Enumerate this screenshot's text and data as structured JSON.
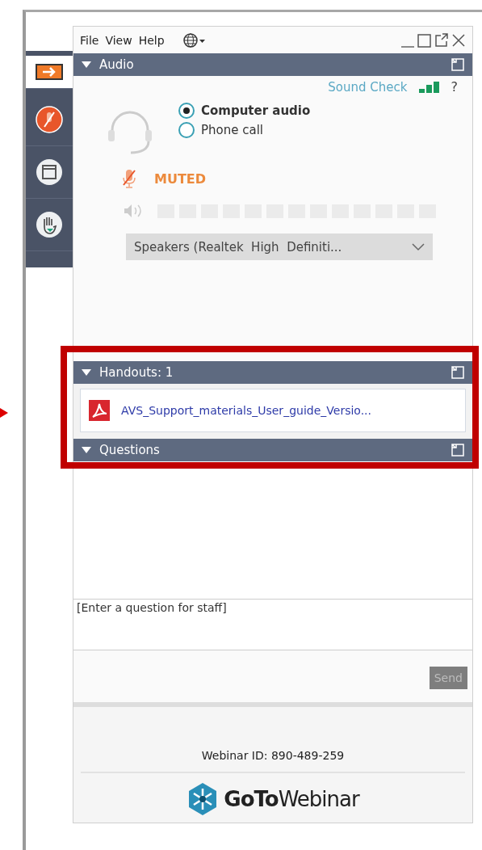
{
  "menu": [
    "File",
    "View",
    "Help"
  ],
  "sidebar": [
    {
      "kind": "arrow",
      "selected": true
    },
    {
      "kind": "mic",
      "selected": false
    },
    {
      "kind": "window",
      "selected": false
    },
    {
      "kind": "hand",
      "selected": false
    }
  ],
  "audio": {
    "title": "Audio",
    "expanded": true,
    "sound_check": "Sound Check",
    "help": "?",
    "options": [
      {
        "label": "Computer audio",
        "selected": true
      },
      {
        "label": "Phone call",
        "selected": false
      }
    ],
    "status": "MUTED",
    "volume": {
      "level": 0
    },
    "device": "Speakers (Realtek  High  Definiti..."
  },
  "handouts": {
    "title": "Handouts: 1",
    "expanded": true,
    "files": [
      "AVS_Support_materials_User_guide_Versio..."
    ]
  },
  "questions": {
    "title": "Questions",
    "expanded": true,
    "input": {
      "placeholder": "[Enter a question for staff]"
    },
    "send": {
      "label": "Send",
      "disabled": true
    }
  },
  "footer": {
    "webinar_id": "Webinar ID: 890-489-259",
    "logo": "**GoTo**Webinar"
  }
}
